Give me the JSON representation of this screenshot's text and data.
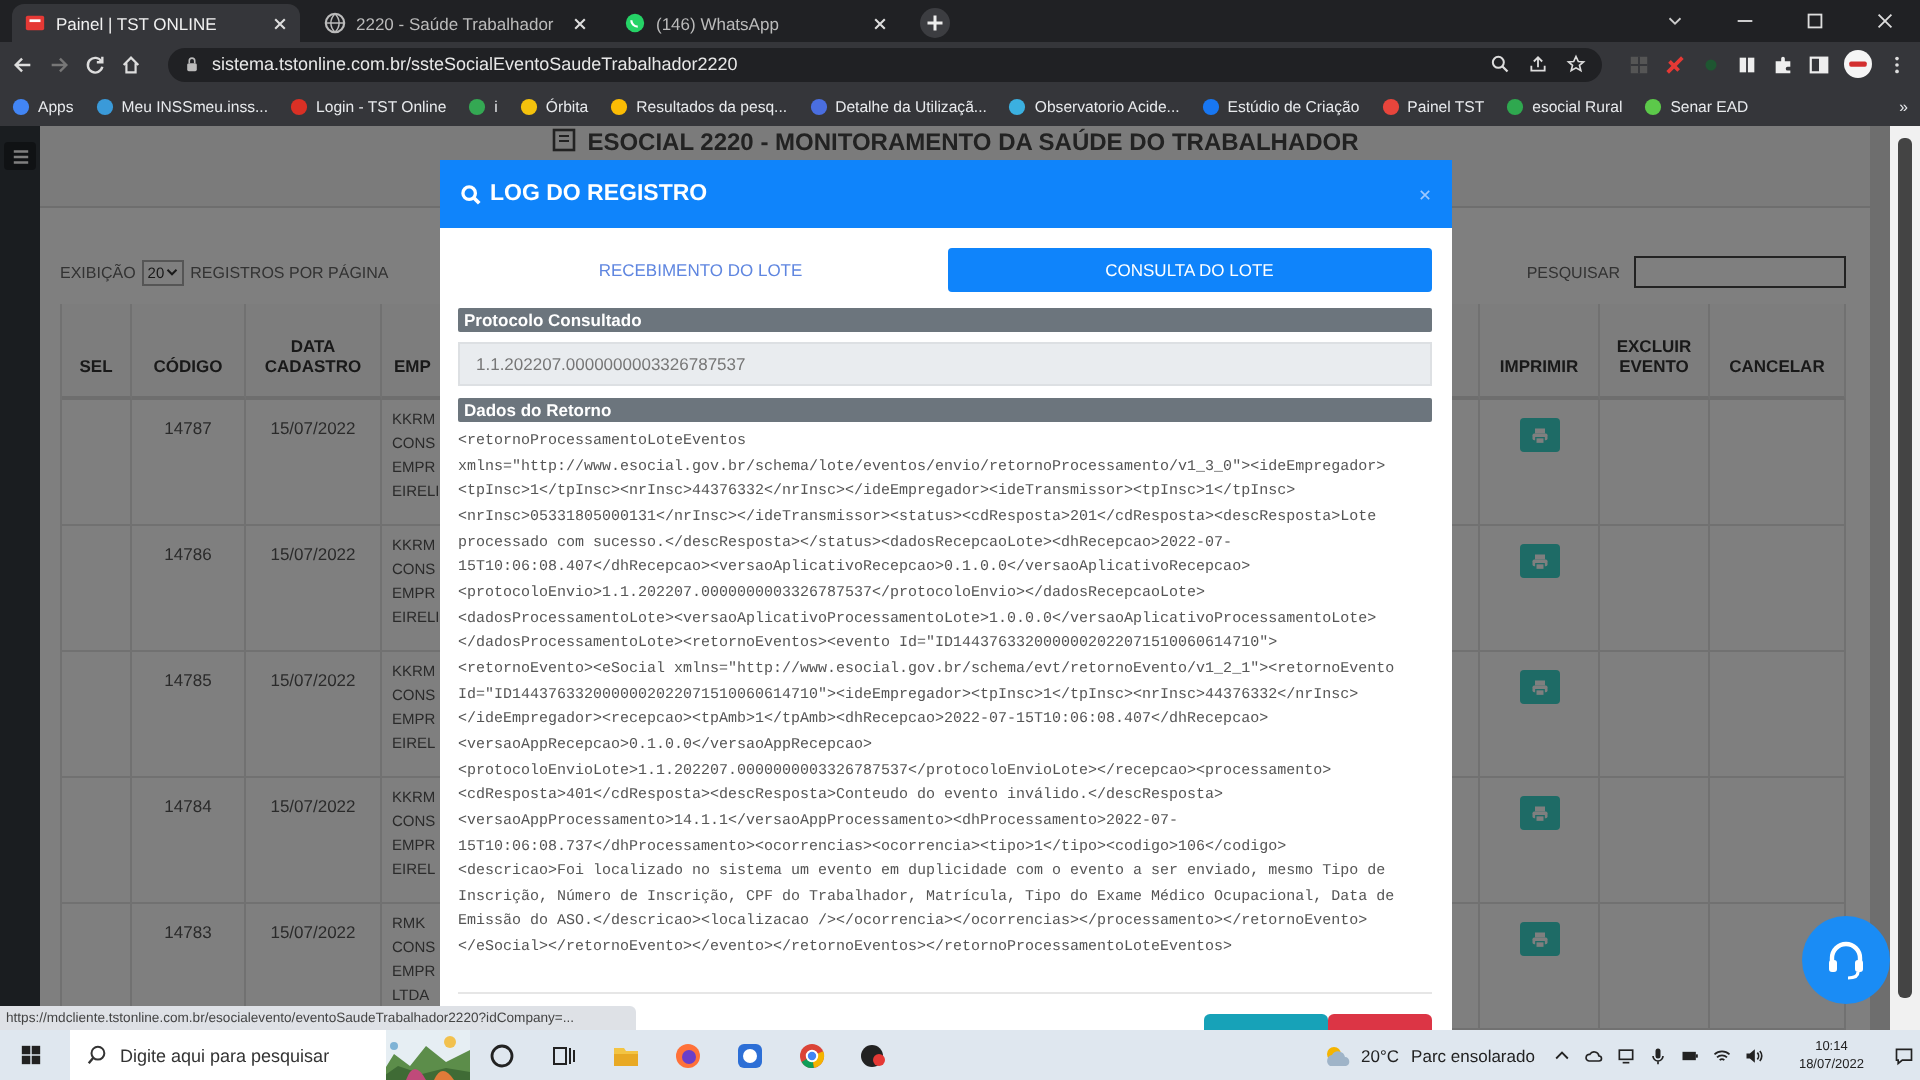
{
  "browser": {
    "tabs": [
      {
        "title": "Painel | TST ONLINE",
        "kind": "tst",
        "selected": true
      },
      {
        "title": "2220 - Saúde Trabalhador",
        "kind": "globe",
        "selected": false
      },
      {
        "title": "(146) WhatsApp",
        "kind": "whatsapp",
        "selected": false
      }
    ],
    "url": "sistema.tstonline.com.br/ssteSocialEventoSaudeTrabalhador2220",
    "bookmarks": [
      {
        "label": "Apps",
        "color": "#4285f4"
      },
      {
        "label": "Meu INSSmeu.inss...",
        "color": "#3a9ad9"
      },
      {
        "label": "Login - TST Online",
        "color": "#d93025"
      },
      {
        "label": "i",
        "color": "#34a853"
      },
      {
        "label": "Órbita",
        "color": "#f4c20d"
      },
      {
        "label": "Resultados da pesq...",
        "color": "#fbbc04"
      },
      {
        "label": "Detalhe da Utilizaçã...",
        "color": "#4a6ee0"
      },
      {
        "label": "Observatorio Acide...",
        "color": "#3bb0e0"
      },
      {
        "label": "Estúdio de Criação",
        "color": "#1877f2"
      },
      {
        "label": "Painel TST",
        "color": "#e8453c"
      },
      {
        "label": "esocial Rural",
        "color": "#2fa84f"
      },
      {
        "label": "Senar EAD",
        "color": "#5cc94a"
      }
    ],
    "more": "»"
  },
  "page": {
    "title": "ESOCIAL 2220 - MONITORAMENTO DA SAÚDE DO TRABALHADOR",
    "show_label": "EXIBIÇÃO",
    "page_size": "20",
    "per_page_label": "REGISTROS POR PÁGINA",
    "search_label": "PESQUISAR",
    "columns": [
      "SEL",
      "CÓDIGO",
      "DATA CADASTRO",
      "EMP",
      "IMPRIMIR",
      "EXCLUIR EVENTO",
      "CANCELAR"
    ],
    "rows": [
      {
        "code": "14787",
        "date": "15/07/2022",
        "company": [
          "KKRM",
          "CONS",
          "EMPR",
          "EIRELI"
        ]
      },
      {
        "code": "14786",
        "date": "15/07/2022",
        "company": [
          "KKRM",
          "CONS",
          "EMPR",
          "EIRELI"
        ]
      },
      {
        "code": "14785",
        "date": "15/07/2022",
        "company": [
          "KKRM",
          "CONS",
          "EMPR",
          "EIREL"
        ]
      },
      {
        "code": "14784",
        "date": "15/07/2022",
        "company": [
          "KKRM",
          "CONS",
          "EMPR",
          "EIREL"
        ]
      },
      {
        "code": "14783",
        "date": "15/07/2022",
        "company": [
          "RMK",
          "CONS",
          "EMPR",
          "LTDA"
        ]
      }
    ]
  },
  "modal": {
    "title": "LOG DO REGISTRO",
    "tabs": [
      {
        "label": "RECEBIMENTO DO LOTE",
        "selected": false
      },
      {
        "label": "CONSULTA DO LOTE",
        "selected": true
      }
    ],
    "protocol_label": "Protocolo Consultado",
    "protocol_value": "1.1.202207.0000000003326787537",
    "return_label": "Dados do Retorno",
    "xml_lines": [
      "<retornoProcessamentoLoteEventos",
      "xmlns=\"http://www.esocial.gov.br/schema/lote/eventos/envio/retornoProcessamento/v1_3_0\"><ideEmpregador>",
      "<tpInsc>1</tpInsc><nrInsc>44376332</nrInsc></ideEmpregador><ideTransmissor><tpInsc>1</tpInsc>",
      "<nrInsc>05331805000131</nrInsc></ideTransmissor><status><cdResposta>201</cdResposta><descResposta>Lote",
      "processado com sucesso.</descResposta></status><dadosRecepcaoLote><dhRecepcao>2022-07-",
      "15T10:06:08.407</dhRecepcao><versaoAplicativoRecepcao>0.1.0.0</versaoAplicativoRecepcao>",
      "<protocoloEnvio>1.1.202207.0000000003326787537</protocoloEnvio></dadosRecepcaoLote>",
      "<dadosProcessamentoLote><versaoAplicativoProcessamentoLote>1.0.0.0</versaoAplicativoProcessamentoLote>",
      "</dadosProcessamentoLote><retornoEventos><evento Id=\"ID1443763320000002022071510060614710\">",
      "<retornoEvento><eSocial xmlns=\"http://www.esocial.gov.br/schema/evt/retornoEvento/v1_2_1\"><retornoEvento",
      "Id=\"ID1443763320000002022071510060614710\"><ideEmpregador><tpInsc>1</tpInsc><nrInsc>44376332</nrInsc>",
      "</ideEmpregador><recepcao><tpAmb>1</tpAmb><dhRecepcao>2022-07-15T10:06:08.407</dhRecepcao>",
      "<versaoAppRecepcao>0.1.0.0</versaoAppRecepcao>",
      "<protocoloEnvioLote>1.1.202207.0000000003326787537</protocoloEnvioLote></recepcao><processamento>",
      "<cdResposta>401</cdResposta><descResposta>Conteudo do evento inválido.</descResposta>",
      "<versaoAppProcessamento>14.1.1</versaoAppProcessamento><dhProcessamento>2022-07-",
      "15T10:06:08.737</dhProcessamento><ocorrencias><ocorrencia><tipo>1</tipo><codigo>106</codigo>",
      "<descricao>Foi localizado no sistema um evento em duplicidade com o evento a ser enviado, mesmo Tipo de",
      "Inscrição, Número de Inscrição, CPF do Trabalhador, Matrícula, Tipo do Exame Médico Ocupacional, Data de",
      "Emissão do ASO.</descricao><localizacao /></ocorrencia></ocorrencias></processamento></retornoEvento>",
      "</eSocial></retornoEvento></evento></retornoEventos></retornoProcessamentoLoteEventos>"
    ]
  },
  "status_url": "https://mdcliente.tstonline.com.br/esocialevento/eventoSaudeTrabalhador2220?idCompany=...",
  "taskbar": {
    "search_placeholder": "Digite aqui para pesquisar",
    "apps": [
      {
        "kind": "cortana"
      },
      {
        "kind": "taskview"
      },
      {
        "kind": "folder"
      },
      {
        "kind": "firefox"
      },
      {
        "kind": "bluebird"
      },
      {
        "kind": "chrome"
      },
      {
        "kind": "redapp"
      }
    ],
    "temperature": "20°C",
    "weather": "Parc ensolarado",
    "time": "10:14",
    "date": "18/07/2022"
  }
}
